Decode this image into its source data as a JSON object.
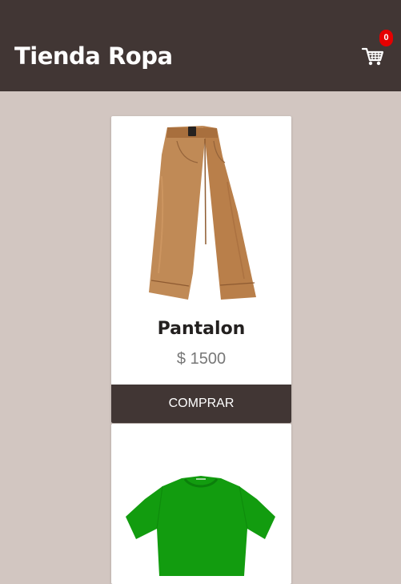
{
  "header": {
    "title": "Tienda Ropa",
    "cart_icon": "shopping-cart-icon",
    "cart_count": "0",
    "background": "#413634"
  },
  "products": [
    {
      "name": "Pantalon",
      "price": "$ 1500",
      "button_label": "COMPRAR",
      "image": "beige-pants",
      "image_color": "#c08a56"
    },
    {
      "image": "green-tshirt",
      "image_color": "#129c0f"
    }
  ],
  "colors": {
    "page_background": "#d2c6c1",
    "badge": "#e50000",
    "button": "#413634"
  }
}
